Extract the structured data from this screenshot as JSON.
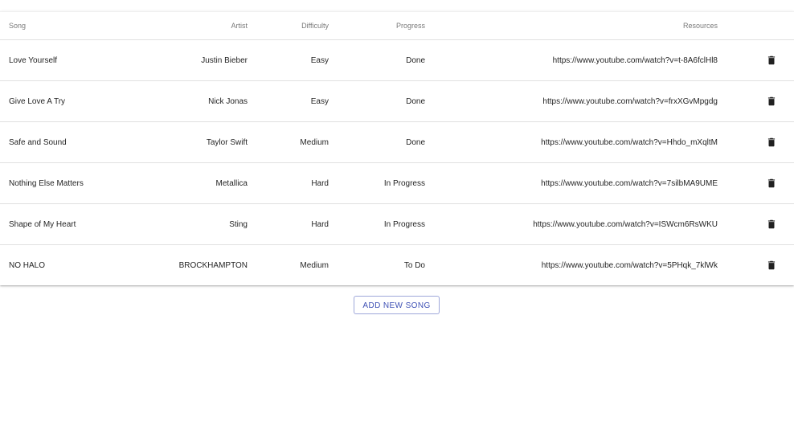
{
  "table": {
    "headers": {
      "song": "Song",
      "artist": "Artist",
      "difficulty": "Difficulty",
      "progress": "Progress",
      "resources": "Resources"
    },
    "rows": [
      {
        "song": "Love Yourself",
        "artist": "Justin Bieber",
        "difficulty": "Easy",
        "progress": "Done",
        "resource": "https://www.youtube.com/watch?v=t-8A6fclHl8"
      },
      {
        "song": "Give Love A Try",
        "artist": "Nick Jonas",
        "difficulty": "Easy",
        "progress": "Done",
        "resource": "https://www.youtube.com/watch?v=frxXGvMpgdg"
      },
      {
        "song": "Safe and Sound",
        "artist": "Taylor Swift",
        "difficulty": "Medium",
        "progress": "Done",
        "resource": "https://www.youtube.com/watch?v=Hhdo_mXqltM"
      },
      {
        "song": "Nothing Else Matters",
        "artist": "Metallica",
        "difficulty": "Hard",
        "progress": "In Progress",
        "resource": "https://www.youtube.com/watch?v=7silbMA9UME"
      },
      {
        "song": "Shape of My Heart",
        "artist": "Sting",
        "difficulty": "Hard",
        "progress": "In Progress",
        "resource": "https://www.youtube.com/watch?v=ISWcm6RsWKU"
      },
      {
        "song": "NO HALO",
        "artist": "BROCKHAMPTON",
        "difficulty": "Medium",
        "progress": "To Do",
        "resource": "https://www.youtube.com/watch?v=5PHqk_7klWk"
      }
    ],
    "row_action_icon": "trash-icon"
  },
  "actions": {
    "add_new_song_label": "ADD NEW SONG"
  },
  "colors": {
    "accent": "#3f51b5",
    "divider": "#e0e0e0"
  }
}
